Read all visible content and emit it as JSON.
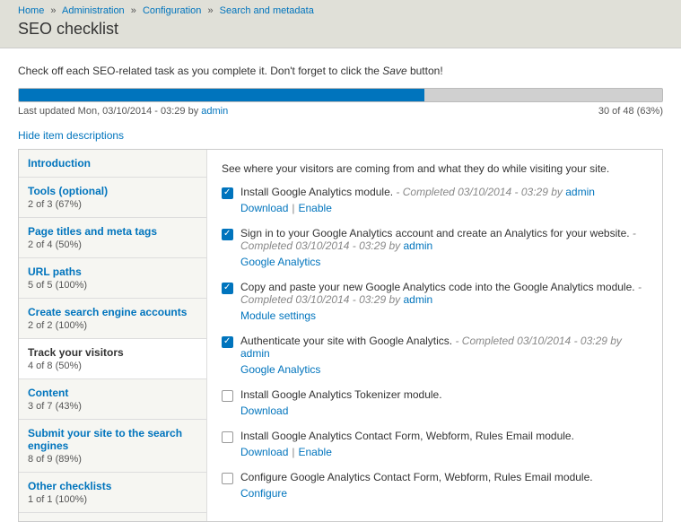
{
  "breadcrumb": {
    "items": [
      {
        "label": "Home"
      },
      {
        "label": "Administration"
      },
      {
        "label": "Configuration"
      },
      {
        "label": "Search and metadata"
      }
    ],
    "sep": "»"
  },
  "page_title": "SEO checklist",
  "intro": {
    "pre": "Check off each SEO-related task as you complete it. Don't forget to click the ",
    "em": "Save",
    "post": " button!"
  },
  "progress": {
    "percent": 63,
    "updated_prefix": "Last updated Mon, 03/10/2014 - 03:29 by ",
    "updated_user": "admin",
    "count_text": "30 of 48 (63%)"
  },
  "toggle_descriptions": "Hide item descriptions",
  "sidebar": [
    {
      "label": "Introduction",
      "meta": ""
    },
    {
      "label": "Tools (optional)",
      "meta": "2 of 3 (67%)"
    },
    {
      "label": "Page titles and meta tags",
      "meta": "2 of 4 (50%)"
    },
    {
      "label": "URL paths",
      "meta": "5 of 5 (100%)"
    },
    {
      "label": "Create search engine accounts",
      "meta": "2 of 2 (100%)"
    },
    {
      "label": "Track your visitors",
      "meta": "4 of 8 (50%)",
      "active": true
    },
    {
      "label": "Content",
      "meta": "3 of 7 (43%)"
    },
    {
      "label": "Submit your site to the search engines",
      "meta": "8 of 9 (89%)"
    },
    {
      "label": "Other checklists",
      "meta": "1 of 1 (100%)"
    }
  ],
  "panel": {
    "desc": "See where your visitors are coming from and what they do while visiting your site.",
    "tasks": [
      {
        "checked": true,
        "title": "Install Google Analytics module.",
        "completed": " - Completed 03/10/2014 - 03:29 by ",
        "user": "admin",
        "links": [
          "Download",
          "Enable"
        ]
      },
      {
        "checked": true,
        "title": "Sign in to your Google Analytics account and create an Analytics for your website.",
        "completed": " - Completed 03/10/2014 - 03:29 by ",
        "user": "admin",
        "links": [
          "Google Analytics"
        ]
      },
      {
        "checked": true,
        "title": "Copy and paste your new Google Analytics code into the Google Analytics module.",
        "completed": " - Completed 03/10/2014 - 03:29 by ",
        "user": "admin",
        "links": [
          "Module settings"
        ]
      },
      {
        "checked": true,
        "title": "Authenticate your site with Google Analytics.",
        "completed": " - Completed 03/10/2014 - 03:29 by ",
        "user": "admin",
        "links": [
          "Google Analytics"
        ]
      },
      {
        "checked": false,
        "title": "Install Google Analytics Tokenizer module.",
        "completed": "",
        "user": "",
        "links": [
          "Download"
        ]
      },
      {
        "checked": false,
        "title": "Install Google Analytics Contact Form, Webform, Rules Email module.",
        "completed": "",
        "user": "",
        "links": [
          "Download",
          "Enable"
        ]
      },
      {
        "checked": false,
        "title": "Configure Google Analytics Contact Form, Webform, Rules Email module.",
        "completed": "",
        "user": "",
        "links": [
          "Configure"
        ]
      }
    ]
  }
}
